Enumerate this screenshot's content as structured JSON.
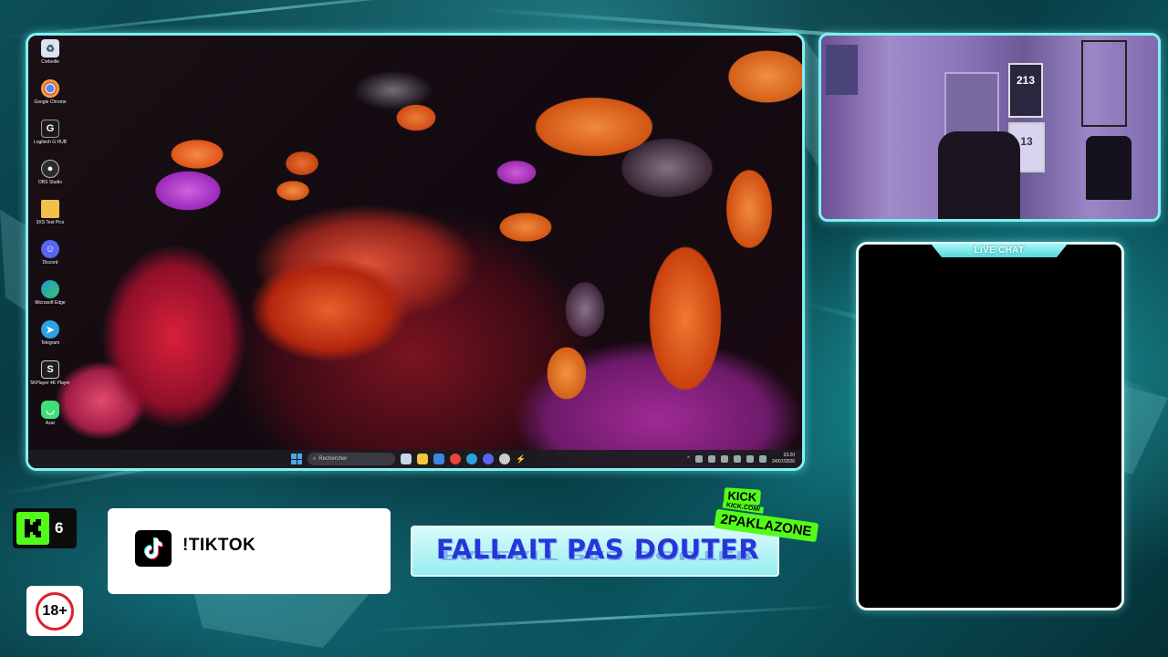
{
  "desktop": {
    "icons": [
      {
        "label": "Corbeille",
        "icon": "recycle-bin-icon",
        "color": "#d8e4f0"
      },
      {
        "label": "Google Chrome",
        "icon": "chrome-icon",
        "color": "#e8453c"
      },
      {
        "label": "Logitech G HUB",
        "icon": "logitech-icon",
        "color": "#1b1b1b"
      },
      {
        "label": "OBS Studio",
        "icon": "obs-icon",
        "color": "#2c2c2c"
      },
      {
        "label": "3XS Test Pics",
        "icon": "folder-icon",
        "color": "#f1c04a"
      },
      {
        "label": "Discord",
        "icon": "discord-icon",
        "color": "#5865f2"
      },
      {
        "label": "Microsoft Edge",
        "icon": "edge-icon",
        "color": "#1d9bd1"
      },
      {
        "label": "Telegram",
        "icon": "telegram-icon",
        "color": "#2aa3de"
      },
      {
        "label": "5KPlayer 4K Player",
        "icon": "player-icon",
        "color": "#1e1e1e"
      },
      {
        "label": "Azar",
        "icon": "azar-icon",
        "color": "#3ee07a"
      }
    ],
    "taskbar": {
      "search_placeholder": "Rechercher",
      "apps": [
        {
          "icon": "widgets-icon",
          "color": "#c9d5e6"
        },
        {
          "icon": "file-explorer-icon",
          "color": "#f4c542"
        },
        {
          "icon": "mail-icon",
          "color": "#3a86e0"
        },
        {
          "icon": "chrome-icon",
          "color": "#e8453c"
        },
        {
          "icon": "telegram-icon",
          "color": "#2aa3de"
        },
        {
          "icon": "discord-icon",
          "color": "#5865f2"
        },
        {
          "icon": "obs-icon",
          "color": "#cccccc"
        },
        {
          "icon": "record-icon",
          "color": "#e03030"
        }
      ],
      "time": "23:20",
      "date": "24/07/2026"
    }
  },
  "overlay": {
    "chat_title": "LIVE CHAT",
    "kick_viewers": "6",
    "age_rating": "18+",
    "tiktok_command": "!TIKTOK",
    "banner_text": "FALLAIT PAS DOUTER",
    "kick_promo": {
      "tag": "KICK",
      "url": "KICK.COM/",
      "channel": "2PAKLAZONE"
    }
  },
  "webcam": {
    "poster_number": "213",
    "jersey_number": "13"
  },
  "colors": {
    "frame_accent": "#7ef1f4",
    "kick_green": "#53fc18",
    "banner_text": "#2636d8",
    "age_red": "#e21d2a"
  }
}
